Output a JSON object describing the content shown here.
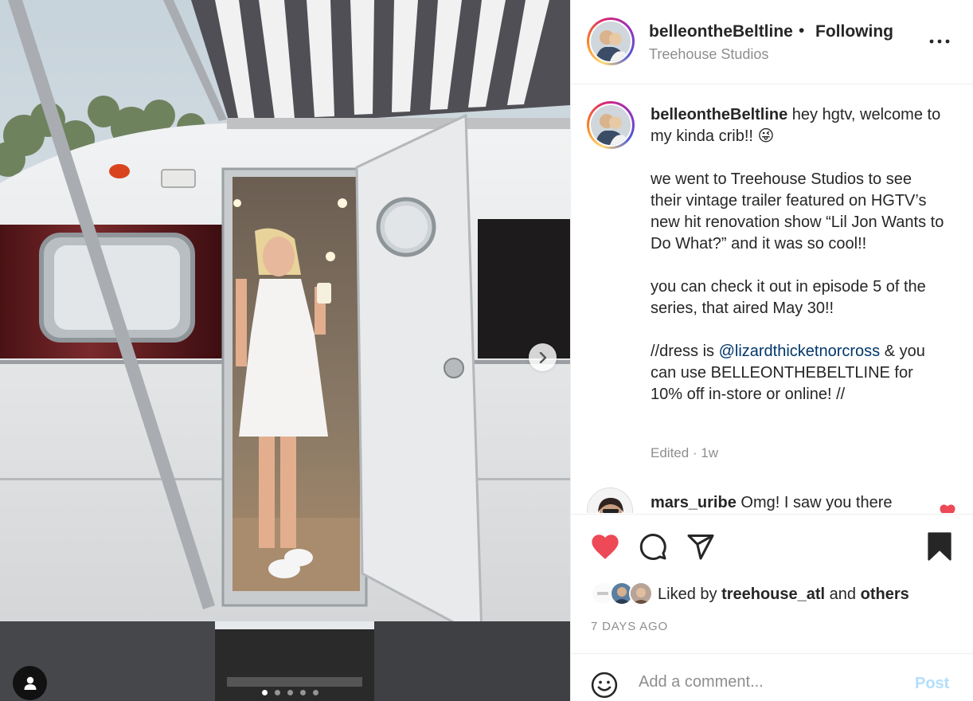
{
  "post": {
    "author": "belleontheBeltline",
    "follow_separator": "•",
    "follow_label": "Following",
    "location": "Treehouse Studios",
    "more_icon": "more-horizontal-icon"
  },
  "caption": {
    "username": "belleontheBeltline",
    "line1": " hey hgtv, welcome to my kinda crib!! 😜",
    "para2": "we went to Treehouse Studios to see their vintage trailer featured on HGTV’s new hit renovation show “Lil Jon Wants to Do What?” and it was so cool!!",
    "para3": "you can check it out in episode 5 of the series, that aired May 30!!",
    "para4_before": "//dress is ",
    "mention": "@lizardthicketnorcross",
    "para4_after": " & you can use BELLEONTHEBELTLINE for 10% off in-store or online! //",
    "edited": "Edited · 1w"
  },
  "comments": [
    {
      "username": "mars_uribe",
      "text": " Omg! I saw you there",
      "liked": true
    }
  ],
  "actions": {
    "liked": true,
    "like_color": "#ed4956",
    "liked_by_prefix": "Liked by ",
    "liked_by_user": "treehouse_atl",
    "liked_by_and": " and ",
    "liked_by_others": "others",
    "date": "7 DAYS AGO"
  },
  "add_comment": {
    "placeholder": "Add a comment...",
    "post_label": "Post"
  },
  "carousel": {
    "slide_count": 5,
    "active_index": 0
  }
}
